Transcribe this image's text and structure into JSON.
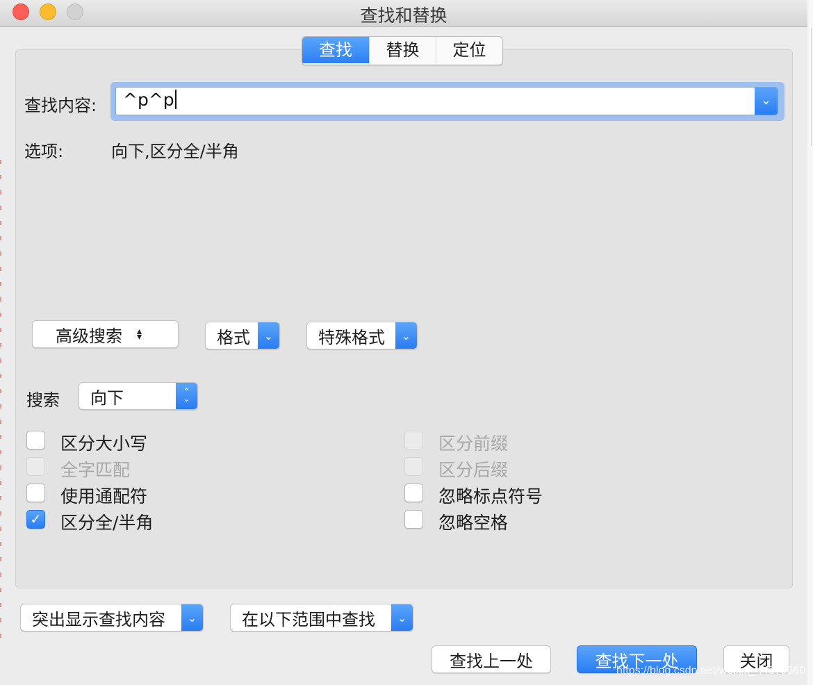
{
  "window": {
    "title": "查找和替换"
  },
  "tabs": [
    {
      "label": "查找",
      "active": true
    },
    {
      "label": "替换",
      "active": false
    },
    {
      "label": "定位",
      "active": false
    }
  ],
  "find": {
    "label": "查找内容:",
    "value": "^p^p"
  },
  "options": {
    "label": "选项:",
    "value": "向下,区分全/半角"
  },
  "buttons": {
    "advanced_search": "高级搜索",
    "format": "格式",
    "special_format": "特殊格式",
    "highlight": "突出显示查找内容",
    "find_in": "在以下范围中查找",
    "find_previous": "查找上一处",
    "find_next": "查找下一处",
    "close": "关闭"
  },
  "search": {
    "label": "搜索",
    "direction": "向下"
  },
  "checkboxes": {
    "match_case": {
      "label": "区分大小写",
      "checked": false,
      "enabled": true
    },
    "whole_word": {
      "label": "全字匹配",
      "checked": false,
      "enabled": false
    },
    "wildcards": {
      "label": "使用通配符",
      "checked": false,
      "enabled": true
    },
    "full_half_width": {
      "label": "区分全/半角",
      "checked": true,
      "enabled": true
    },
    "match_prefix": {
      "label": "区分前缀",
      "checked": false,
      "enabled": false
    },
    "match_suffix": {
      "label": "区分后缀",
      "checked": false,
      "enabled": false
    },
    "ignore_punctuation": {
      "label": "忽略标点符号",
      "checked": false,
      "enabled": true
    },
    "ignore_spaces": {
      "label": "忽略空格",
      "checked": false,
      "enabled": true
    }
  },
  "watermark": "https://blog.csdn.net/weixin_44375660",
  "colors": {
    "accent": "#2d7ff4",
    "window_bg": "#ececec",
    "panel_bg": "#e3e3e3",
    "disabled_text": "#a9a9a9"
  }
}
